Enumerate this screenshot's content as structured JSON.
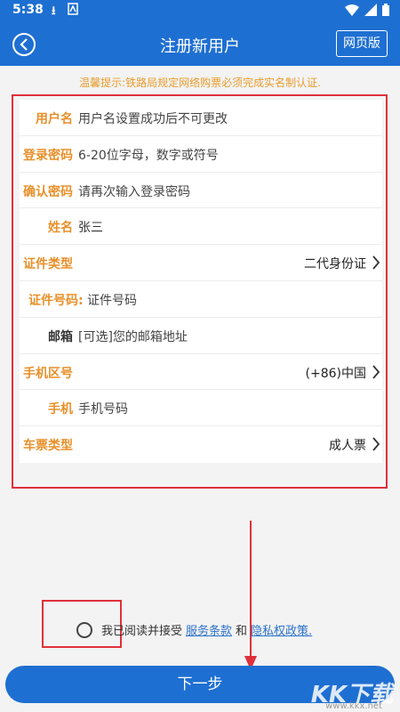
{
  "status_bar": {
    "time": "5:38"
  },
  "app_bar": {
    "title": "注册新用户",
    "web_button": "网页版"
  },
  "tip": "温馨提示:铁路局规定网络购票必须完成实名制认证.",
  "form": {
    "username": {
      "label": "用户名",
      "placeholder": "用户名设置成功后不可更改"
    },
    "password": {
      "label": "登录密码",
      "placeholder": "6-20位字母，数字或符号"
    },
    "confirm_password": {
      "label": "确认密码",
      "placeholder": "请再次输入登录密码"
    },
    "name": {
      "label": "姓名",
      "value": "张三"
    },
    "id_type": {
      "label": "证件类型",
      "value": "二代身份证"
    },
    "id_number": {
      "label": "证件号码:",
      "placeholder": "证件号码"
    },
    "email": {
      "label": "邮箱",
      "placeholder": "[可选]您的邮箱地址"
    },
    "area_code": {
      "label": "手机区号",
      "value": "(+86)中国"
    },
    "phone": {
      "label": "手机",
      "placeholder": "手机号码"
    },
    "ticket_type": {
      "label": "车票类型",
      "value": "成人票"
    }
  },
  "agreement": {
    "prefix": "我已阅读并接受",
    "terms": "服务条款",
    "and": "和",
    "privacy": "隐私权政策."
  },
  "next_button": "下一步",
  "watermark": {
    "logo": "KK下载",
    "url": "www.kkx.net"
  },
  "colors": {
    "primary": "#1e6fd2",
    "label_orange": "#e8902a",
    "highlight_red": "#e0303b",
    "link": "#2b72c9"
  }
}
